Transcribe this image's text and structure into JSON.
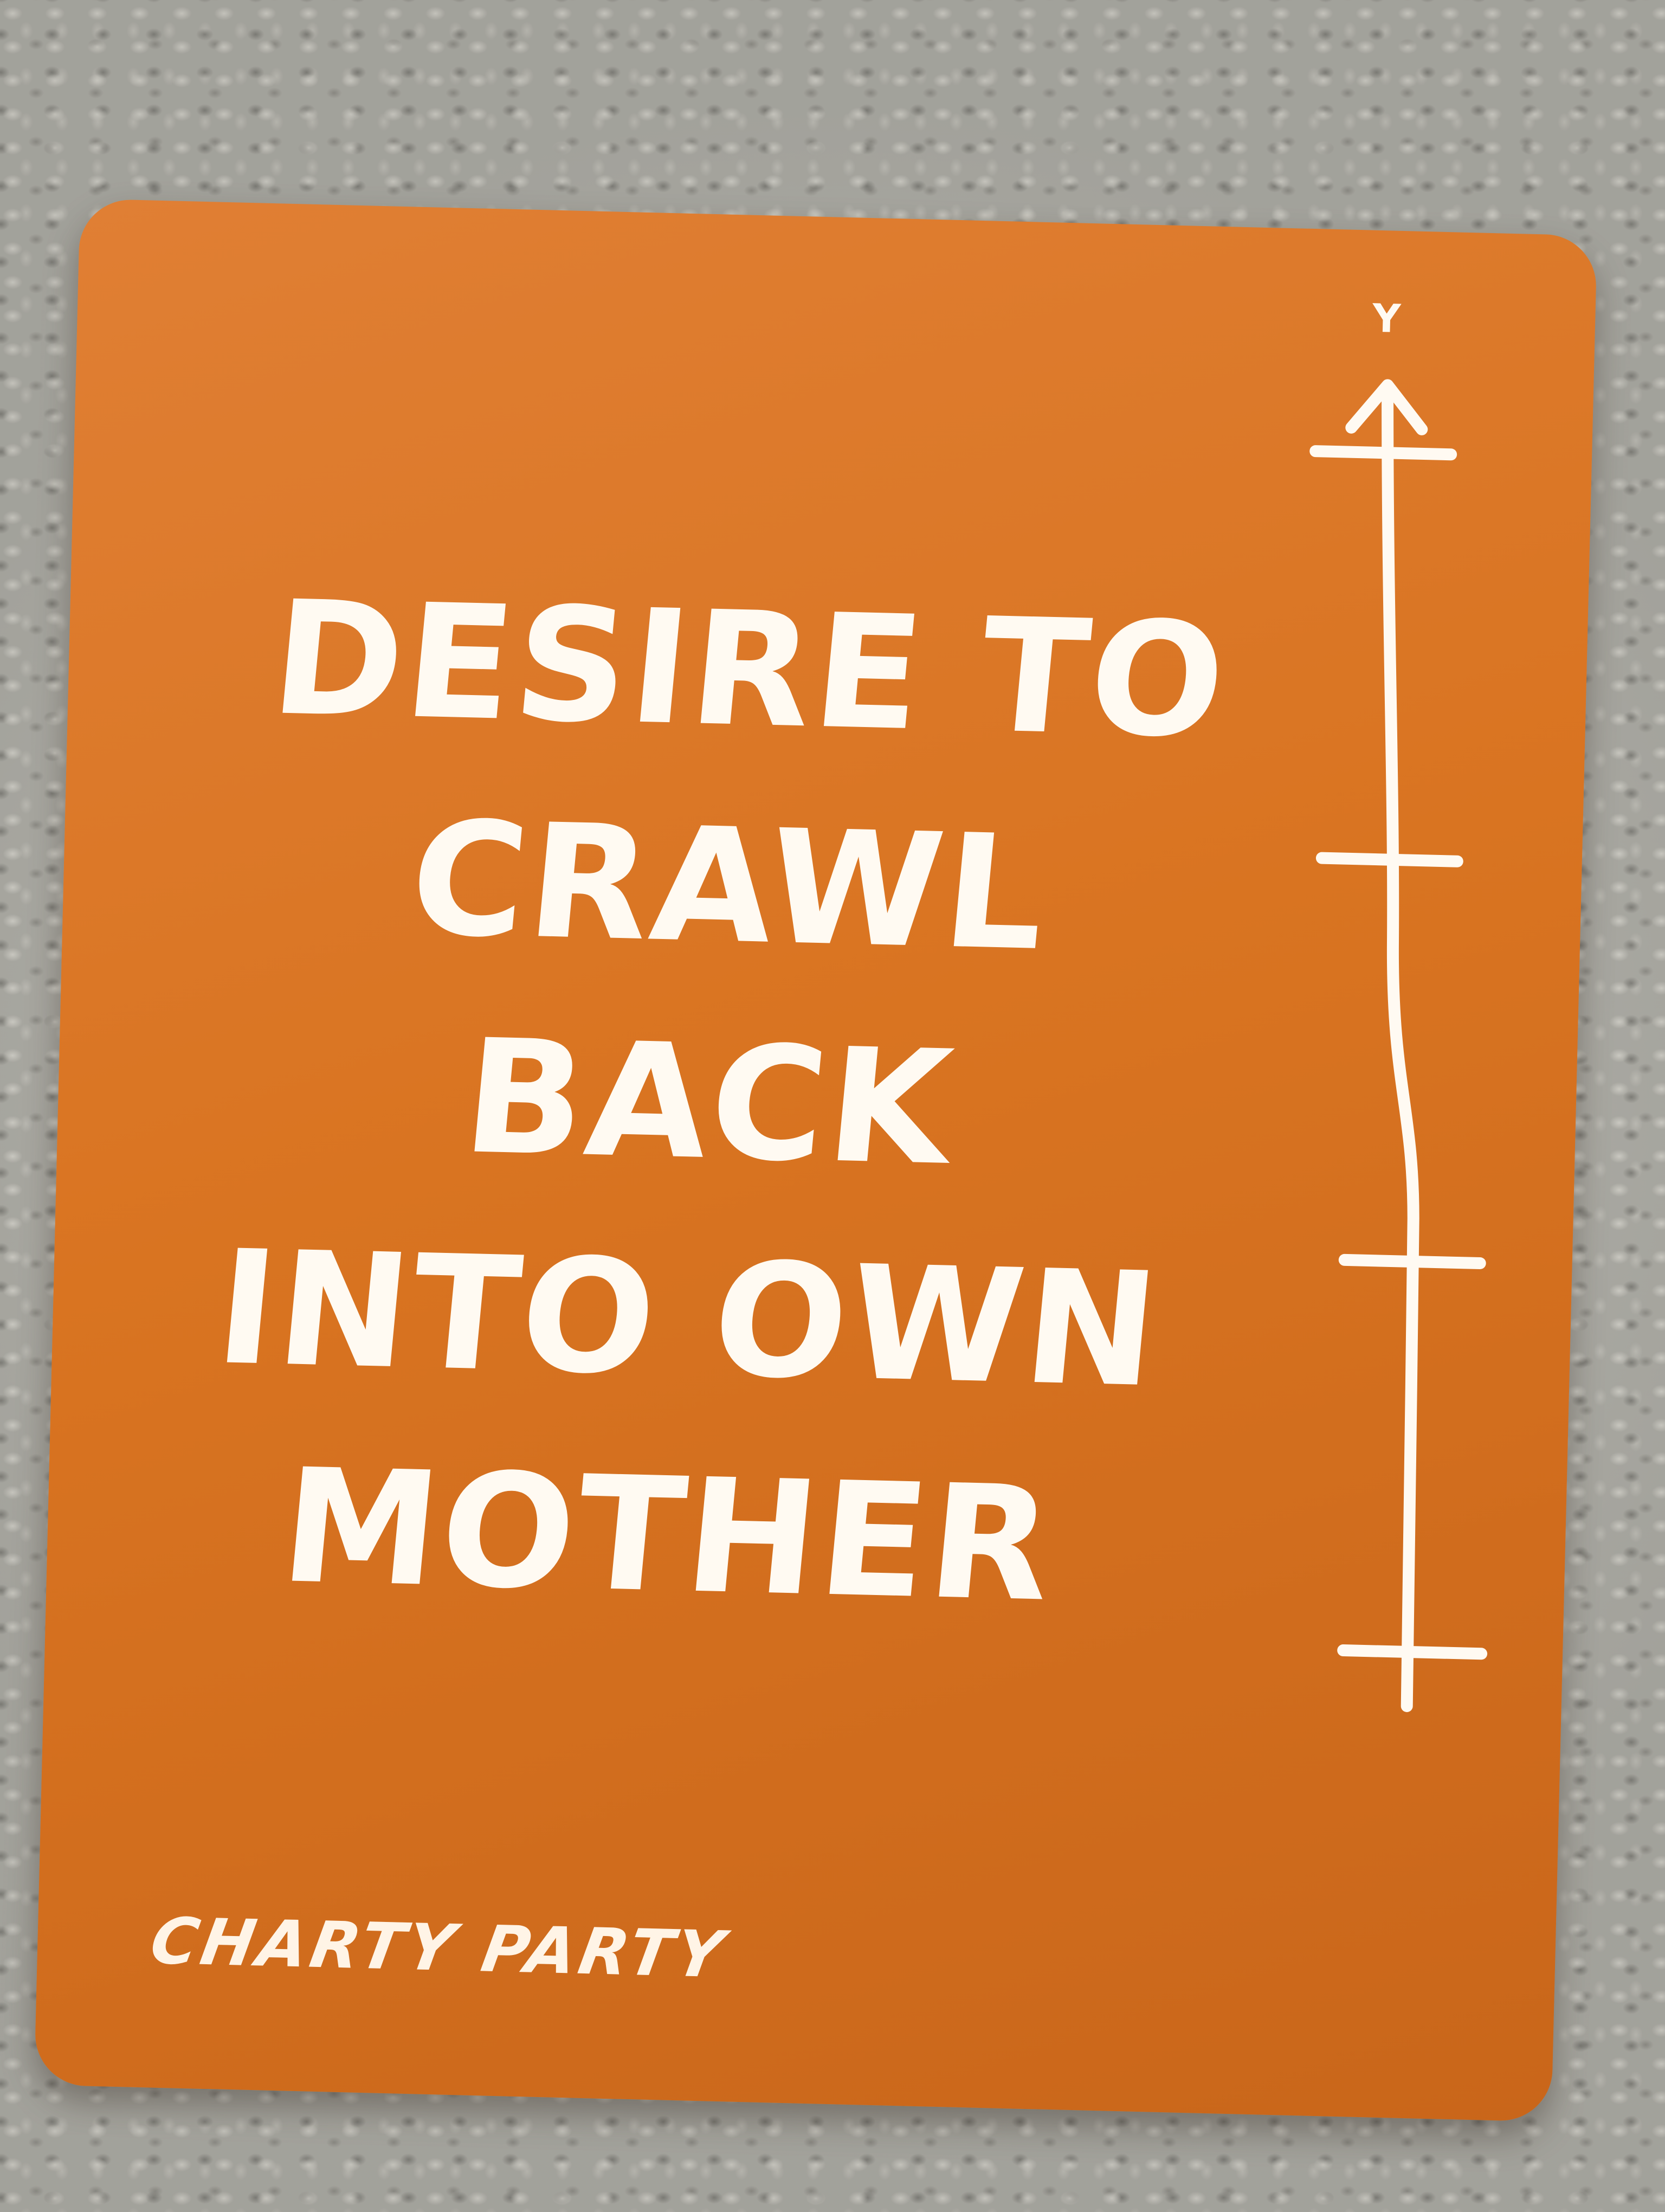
{
  "photo": {
    "background": "carpet",
    "colors": {
      "carpet": "#b9b8b1",
      "card": "#d97421",
      "ink": "#fffaf2"
    }
  },
  "card": {
    "lines": [
      "DESIRE TO",
      "CRAWL BACK",
      "INTO OWN",
      "MOTHER"
    ],
    "brand": "CHARTY PARTY",
    "axis": {
      "label": "Y",
      "icon": "arrow-up-icon",
      "tick_count": 4
    }
  }
}
